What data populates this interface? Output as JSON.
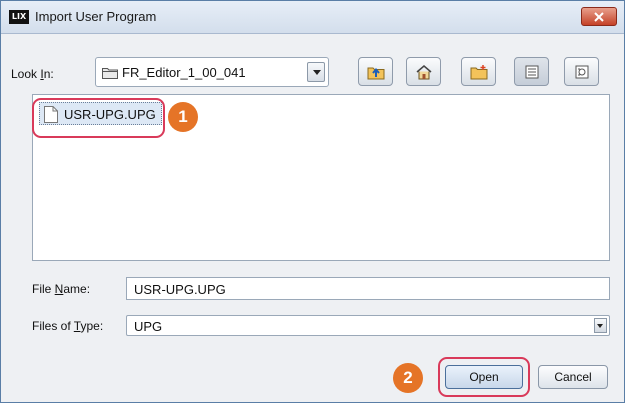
{
  "window": {
    "title": "Import User Program",
    "app_icon": "LIX-logo-icon"
  },
  "toolbar": {
    "look_in_label_pre": "Look ",
    "look_in_label_key": "I",
    "look_in_label_post": "n:",
    "current_folder": "FR_Editor_1_00_041",
    "buttons": [
      "up-one-level-icon",
      "home-icon",
      "new-folder-icon",
      "list-view-icon",
      "details-view-icon"
    ]
  },
  "file_list": {
    "items": [
      {
        "name": "USR-UPG.UPG",
        "selected": true
      }
    ]
  },
  "file_name": {
    "label_pre": "File ",
    "label_key": "N",
    "label_post": "ame:",
    "value": "USR-UPG.UPG"
  },
  "file_type": {
    "label_pre": "Files of ",
    "label_key": "T",
    "label_post": "ype:",
    "value": "UPG"
  },
  "buttons": {
    "open": "Open",
    "cancel": "Cancel"
  },
  "annotations": {
    "step1": "1",
    "step2": "2",
    "color": "#e57427",
    "highlight_color": "#d93a5a"
  }
}
